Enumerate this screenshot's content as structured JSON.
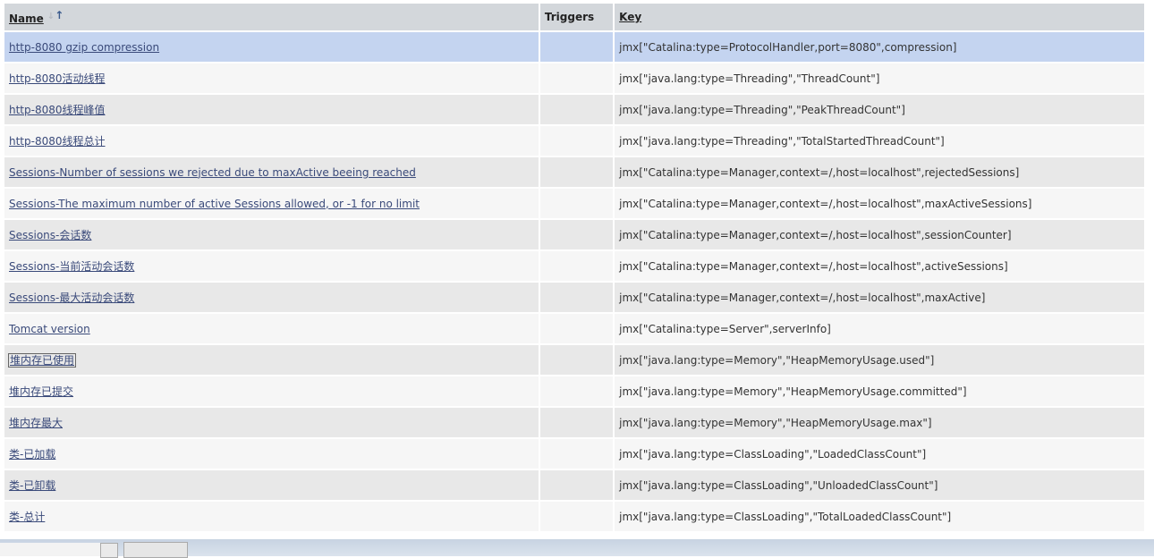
{
  "table": {
    "headers": {
      "name": "Name",
      "triggers": "Triggers",
      "key": "Key"
    },
    "rows": [
      {
        "name": "http-8080 gzip compression",
        "triggers": "",
        "key": "jmx[\"Catalina:type=ProtocolHandler,port=8080\",compression]"
      },
      {
        "name": "http-8080活动线程",
        "triggers": "",
        "key": "jmx[\"java.lang:type=Threading\",\"ThreadCount\"]"
      },
      {
        "name": "http-8080线程峰值",
        "triggers": "",
        "key": "jmx[\"java.lang:type=Threading\",\"PeakThreadCount\"]"
      },
      {
        "name": "http-8080线程总计",
        "triggers": "",
        "key": "jmx[\"java.lang:type=Threading\",\"TotalStartedThreadCount\"]"
      },
      {
        "name": "Sessions-Number of sessions we rejected due to maxActive beeing reached",
        "triggers": "",
        "key": "jmx[\"Catalina:type=Manager,context=/,host=localhost\",rejectedSessions]"
      },
      {
        "name": "Sessions-The maximum number of active Sessions allowed, or -1 for no limit",
        "triggers": "",
        "key": "jmx[\"Catalina:type=Manager,context=/,host=localhost\",maxActiveSessions]"
      },
      {
        "name": "Sessions-会话数",
        "triggers": "",
        "key": "jmx[\"Catalina:type=Manager,context=/,host=localhost\",sessionCounter]"
      },
      {
        "name": "Sessions-当前活动会话数",
        "triggers": "",
        "key": "jmx[\"Catalina:type=Manager,context=/,host=localhost\",activeSessions]"
      },
      {
        "name": "Sessions-最大活动会话数",
        "triggers": "",
        "key": "jmx[\"Catalina:type=Manager,context=/,host=localhost\",maxActive]"
      },
      {
        "name": "Tomcat version",
        "triggers": "",
        "key": "jmx[\"Catalina:type=Server\",serverInfo]"
      },
      {
        "name": "堆内存已使用",
        "triggers": "",
        "key": "jmx[\"java.lang:type=Memory\",\"HeapMemoryUsage.used\"]"
      },
      {
        "name": "堆内存已提交",
        "triggers": "",
        "key": "jmx[\"java.lang:type=Memory\",\"HeapMemoryUsage.committed\"]"
      },
      {
        "name": "堆内存最大",
        "triggers": "",
        "key": "jmx[\"java.lang:type=Memory\",\"HeapMemoryUsage.max\"]"
      },
      {
        "name": "类-已加载",
        "triggers": "",
        "key": "jmx[\"java.lang:type=ClassLoading\",\"LoadedClassCount\"]"
      },
      {
        "name": "类-已卸载",
        "triggers": "",
        "key": "jmx[\"java.lang:type=ClassLoading\",\"UnloadedClassCount\"]"
      },
      {
        "name": "类-总计",
        "triggers": "",
        "key": "jmx[\"java.lang:type=ClassLoading\",\"TotalLoadedClassCount\"]"
      }
    ],
    "selected_row": 0,
    "boxed_row": 10
  },
  "icons": {
    "sort": "sort-ascending-icon"
  },
  "colors": {
    "selected_row": "#c4d4f0",
    "header_bg": "#d3d7db",
    "link": "#3a4a7a"
  }
}
